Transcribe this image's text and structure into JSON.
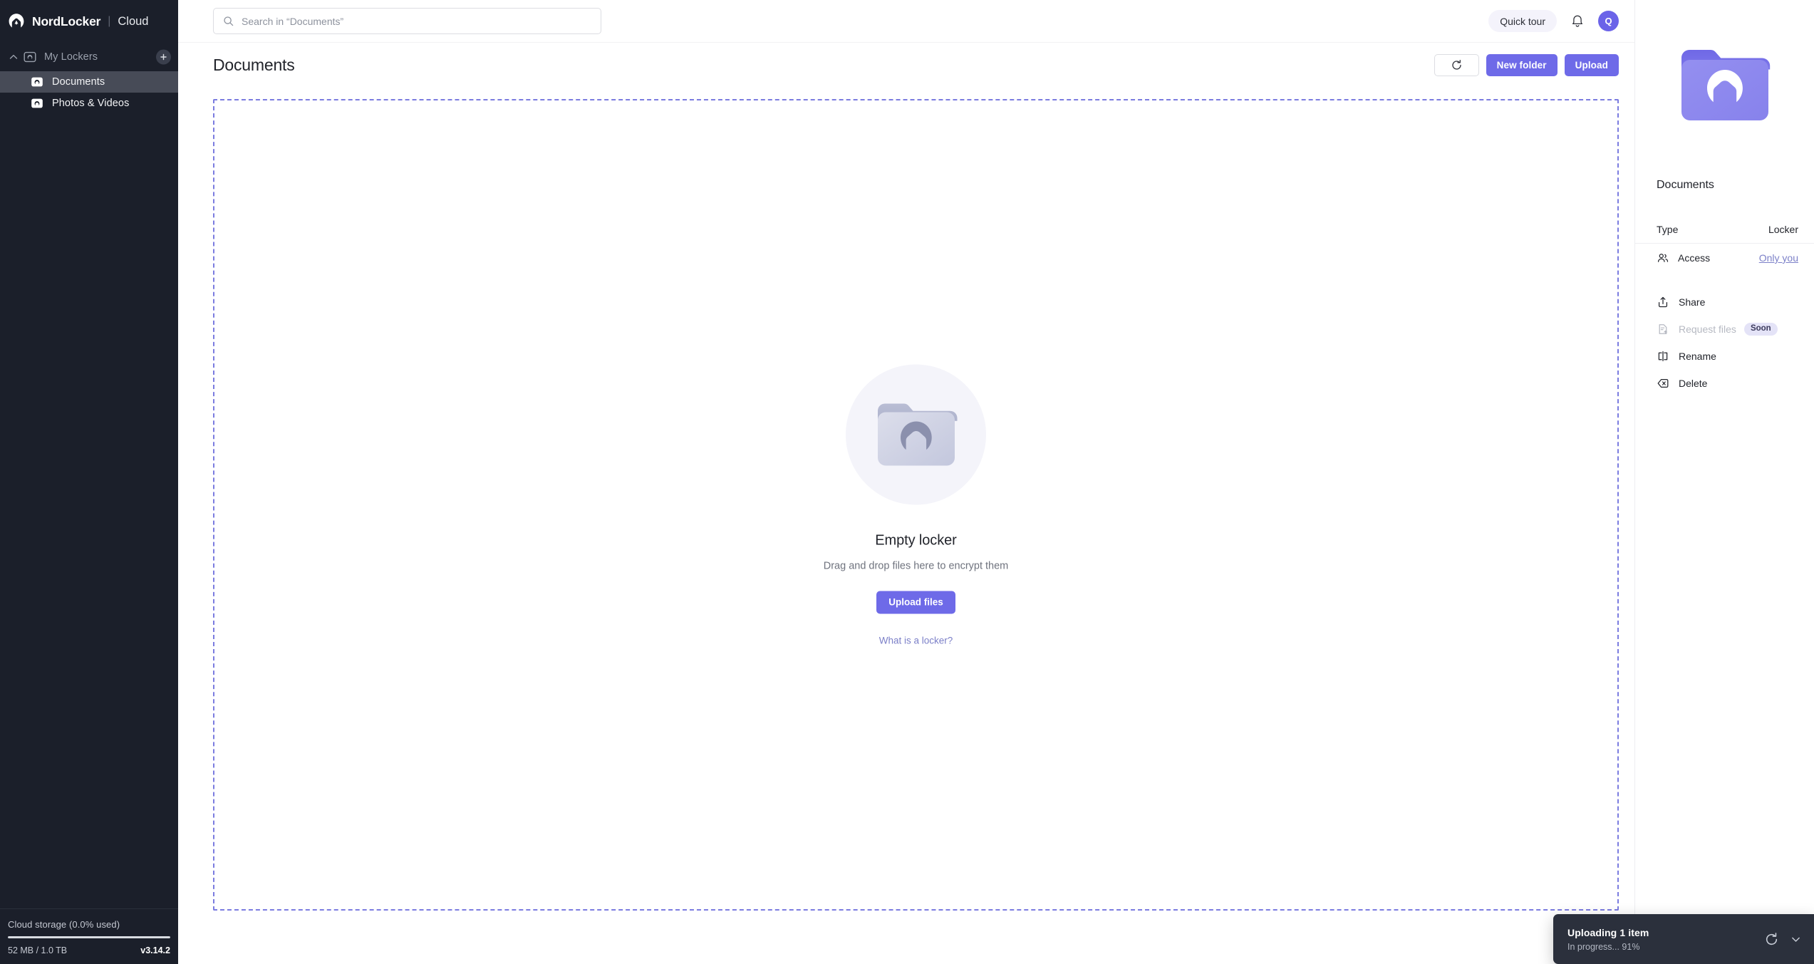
{
  "brand": {
    "name": "NordLocker",
    "separator": "|",
    "product": "Cloud",
    "logo_icon": "nordlocker-mountain-logo"
  },
  "sidebar": {
    "section": {
      "label": "My Lockers",
      "collapse_icon": "chevron-up-icon",
      "section_icon": "locker-outline-icon",
      "add_icon": "plus-icon"
    },
    "items": [
      {
        "label": "Documents",
        "icon": "locker-icon",
        "active": true
      },
      {
        "label": "Photos & Videos",
        "icon": "locker-icon",
        "active": false
      }
    ],
    "storage": {
      "title": "Cloud storage (0.0% used)",
      "used_text": "52 MB / 1.0 TB",
      "percent": 0.0,
      "version": "v3.14.2"
    }
  },
  "topbar": {
    "search": {
      "placeholder": "Search in “Documents”",
      "value": "",
      "icon": "search-icon"
    },
    "quick_tour_label": "Quick tour",
    "notifications_icon": "bell-icon",
    "avatar_letter": "Q"
  },
  "page": {
    "title": "Documents",
    "refresh_icon": "refresh-icon",
    "new_folder_label": "New folder",
    "upload_label": "Upload"
  },
  "empty_state": {
    "illustration_icon": "empty-locker-folder-icon",
    "title": "Empty locker",
    "subtitle": "Drag and drop files here to encrypt them",
    "upload_button_label": "Upload files",
    "help_link_label": "What is a locker?"
  },
  "details": {
    "thumbnail_icon": "locker-folder-purple-icon",
    "name": "Documents",
    "rows": [
      {
        "label": "Type",
        "value": "Locker",
        "icon": null,
        "link": false
      },
      {
        "label": "Access",
        "value": "Only you",
        "icon": "people-icon",
        "link": true
      }
    ],
    "actions": [
      {
        "label": "Share",
        "icon": "share-icon",
        "disabled": false,
        "badge": null
      },
      {
        "label": "Request files",
        "icon": "request-files-icon",
        "disabled": true,
        "badge": "Soon"
      },
      {
        "label": "Rename",
        "icon": "rename-icon",
        "disabled": false,
        "badge": null
      },
      {
        "label": "Delete",
        "icon": "delete-icon",
        "disabled": false,
        "badge": null
      }
    ]
  },
  "toast": {
    "title": "Uploading 1 item",
    "subtitle": "In progress... 91%",
    "progress_percent": 91,
    "retry_icon": "refresh-icon",
    "collapse_icon": "chevron-down-icon"
  },
  "colors": {
    "accent": "#6e6ae8",
    "sidebar_bg": "#1b1f2a",
    "sidebar_active": "#474b57",
    "dropzone_border": "#7b7ce0",
    "link": "#7c80c8",
    "toast_bg": "#2b303c",
    "badge_bg": "#e4e3f7"
  }
}
